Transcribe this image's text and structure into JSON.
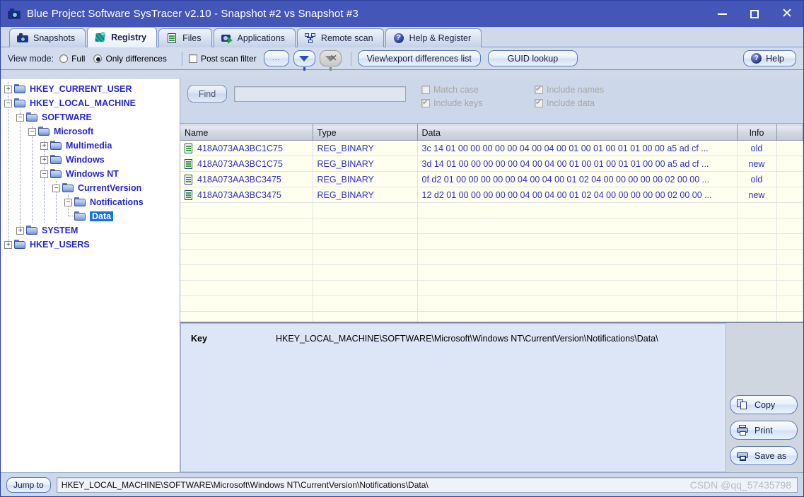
{
  "window": {
    "title": "Blue Project Software SysTracer v2.10 - Snapshot #2 vs Snapshot #3",
    "icon": "camera-icon",
    "minimize": "—",
    "maximize": "□",
    "close": "✕",
    "accent": "#4456b8"
  },
  "tabs": [
    {
      "label": "Snapshots",
      "icon": "camera-icon",
      "active": false
    },
    {
      "label": "Registry",
      "icon": "registry-icon",
      "active": true
    },
    {
      "label": "Files",
      "icon": "file-icon",
      "active": false
    },
    {
      "label": "Applications",
      "icon": "application-icon",
      "active": false
    },
    {
      "label": "Remote scan",
      "icon": "network-icon",
      "active": false
    },
    {
      "label": "Help & Register",
      "icon": "help-icon",
      "active": false
    }
  ],
  "toolbar": {
    "view_mode_label": "View mode:",
    "full_label": "Full",
    "full_selected": false,
    "only_differences_label": "Only differences",
    "only_differences_selected": true,
    "post_scan_filter_label": "Post scan filter",
    "post_scan_filter_checked": false,
    "ellipsis_label": "...",
    "filter_icon": "funnel-icon",
    "clear_filter_icon": "funnel-clear-icon",
    "view_export_label": "View\\export differences list",
    "guid_lookup_label": "GUID lookup",
    "help_label": "Help",
    "help_icon": "help-icon"
  },
  "tree": [
    {
      "label": "HKEY_CURRENT_USER",
      "depth": 0,
      "expander": "+",
      "selected": false
    },
    {
      "label": "HKEY_LOCAL_MACHINE",
      "depth": 0,
      "expander": "-",
      "selected": false
    },
    {
      "label": "SOFTWARE",
      "depth": 1,
      "expander": "-",
      "selected": false
    },
    {
      "label": "Microsoft",
      "depth": 2,
      "expander": "-",
      "selected": false
    },
    {
      "label": "Multimedia",
      "depth": 3,
      "expander": "+",
      "selected": false
    },
    {
      "label": "Windows",
      "depth": 3,
      "expander": "+",
      "selected": false
    },
    {
      "label": "Windows NT",
      "depth": 3,
      "expander": "-",
      "selected": false
    },
    {
      "label": "CurrentVersion",
      "depth": 4,
      "expander": "-",
      "selected": false
    },
    {
      "label": "Notifications",
      "depth": 5,
      "expander": "-",
      "selected": false
    },
    {
      "label": "Data",
      "depth": 6,
      "expander": "",
      "selected": true
    },
    {
      "label": "SYSTEM",
      "depth": 1,
      "expander": "+",
      "selected": false
    },
    {
      "label": "HKEY_USERS",
      "depth": 0,
      "expander": "+",
      "selected": false
    }
  ],
  "find": {
    "button_label": "Find",
    "input_value": "",
    "options": [
      {
        "label": "Match case",
        "checked": false,
        "disabled": true
      },
      {
        "label": "Include names",
        "checked": true,
        "disabled": true
      },
      {
        "label": "Include keys",
        "checked": true,
        "disabled": true
      },
      {
        "label": "Include data",
        "checked": true,
        "disabled": true
      }
    ]
  },
  "table": {
    "columns": [
      "Name",
      "Type",
      "Data",
      "Info",
      ""
    ],
    "rows": [
      {
        "icon": "registry-value-icon",
        "name": "418A073AA3BC1C75",
        "type": "REG_BINARY",
        "data": "3c 14 01 00 00 00 00 00 04 00 04 00 01 00 01 00 01 01 00 00 a5 ad cf ...",
        "info": "old"
      },
      {
        "icon": "registry-value-icon",
        "name": "418A073AA3BC1C75",
        "type": "REG_BINARY",
        "data": "3d 14 01 00 00 00 00 00 04 00 04 00 01 00 01 00 01 01 00 00 a5 ad cf ...",
        "info": "new"
      },
      {
        "icon": "registry-value-icon",
        "name": "418A073AA3BC3475",
        "type": "REG_BINARY",
        "data": "0f d2 01 00 00 00 00 00 04 00 04 00 01 02 04 00 00 00 00 00 02 00 00 ...",
        "info": "old"
      },
      {
        "icon": "registry-value-icon",
        "name": "418A073AA3BC3475",
        "type": "REG_BINARY",
        "data": "12 d2 01 00 00 00 00 00 04 00 04 00 01 02 04 00 00 00 00 00 02 00 00 ...",
        "info": "new"
      }
    ],
    "empty_row_count": 8
  },
  "detail": {
    "key_label": "Key",
    "key_value": "HKEY_LOCAL_MACHINE\\SOFTWARE\\Microsoft\\Windows NT\\CurrentVersion\\Notifications\\Data\\",
    "buttons": [
      {
        "label": "Copy",
        "icon": "copy-icon"
      },
      {
        "label": "Print",
        "icon": "printer-icon"
      },
      {
        "label": "Save as",
        "icon": "save-icon"
      }
    ]
  },
  "status": {
    "jump_to_label": "Jump to",
    "path": "HKEY_LOCAL_MACHINE\\SOFTWARE\\Microsoft\\Windows NT\\CurrentVersion\\Notifications\\Data\\",
    "watermark": "CSDN @qq_57435798"
  }
}
